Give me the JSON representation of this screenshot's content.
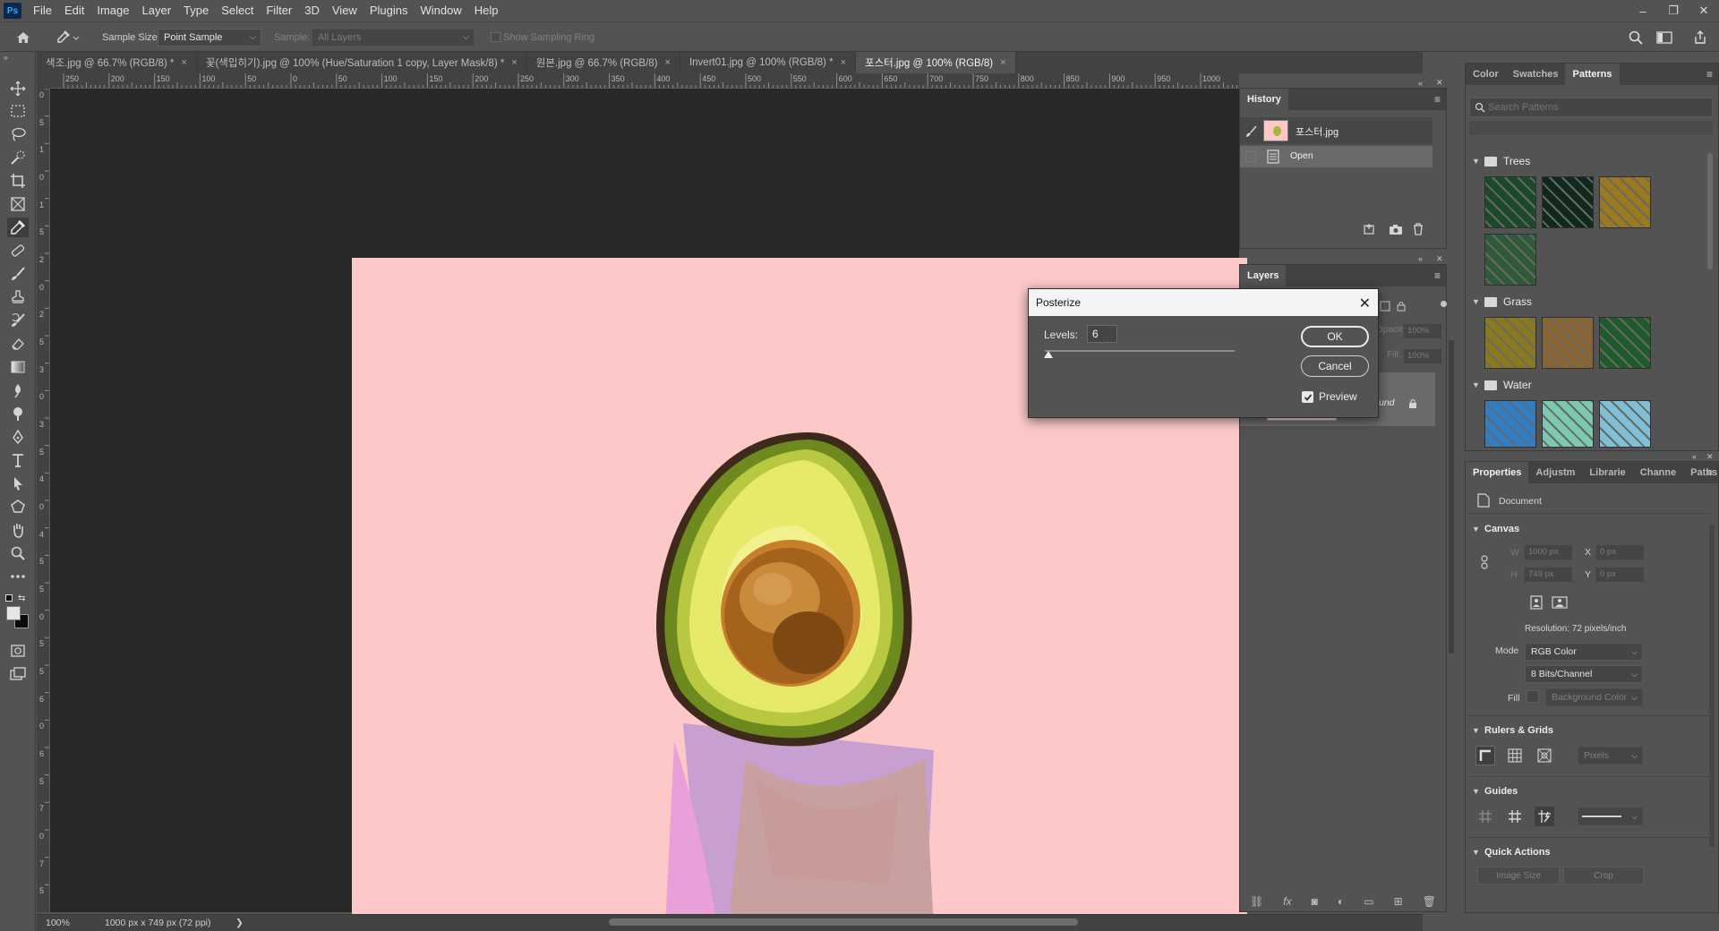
{
  "app": {
    "logo": "Ps"
  },
  "menu": [
    "File",
    "Edit",
    "Image",
    "Layer",
    "Type",
    "Select",
    "Filter",
    "3D",
    "View",
    "Plugins",
    "Window",
    "Help"
  ],
  "window_controls": {
    "minimize": "–",
    "restore": "❐",
    "close": "✕"
  },
  "options_bar": {
    "sample_size_label": "Sample Size:",
    "sample_size_value": "Point Sample",
    "sample_label": "Sample:",
    "sample_value": "All Layers",
    "sampling_ring_label": "Show Sampling Ring",
    "caret": "⌵"
  },
  "tabs": [
    {
      "label": "색조.jpg @ 66.7% (RGB/8) *",
      "close": "×"
    },
    {
      "label": "꽃(색입히기).jpg @ 100% (Hue/Saturation 1 copy, Layer Mask/8) *",
      "close": "×"
    },
    {
      "label": "원본.jpg @ 66.7% (RGB/8)",
      "close": "×"
    },
    {
      "label": "Invert01.jpg @ 100% (RGB/8) *",
      "close": "×"
    },
    {
      "label": "포스터.jpg @ 100% (RGB/8)",
      "close": "×"
    }
  ],
  "ruler": {
    "top": [
      "250",
      "200",
      "150",
      "100",
      "50",
      "0",
      "50",
      "100",
      "150",
      "200",
      "250",
      "300",
      "350",
      "400",
      "450",
      "500",
      "550",
      "600",
      "650",
      "700",
      "750",
      "800",
      "850",
      "900",
      "950",
      "1000"
    ],
    "left": [
      "0",
      "5",
      "1",
      "0",
      "1",
      "5",
      "2",
      "0",
      "2",
      "5",
      "3",
      "0",
      "3",
      "5",
      "4",
      "0",
      "4",
      "5",
      "5",
      "0",
      "5",
      "5",
      "6",
      "0",
      "6",
      "5",
      "7",
      "0",
      "7",
      "5"
    ]
  },
  "status": {
    "zoom": "100%",
    "doc_info": "1000 px x 749 px (72 ppi)",
    "arrow": "❯"
  },
  "history": {
    "title": "History",
    "snapshot_name": "포스터.jpg",
    "items": [
      {
        "label": "Open"
      }
    ]
  },
  "layers": {
    "title": "Layers",
    "opacity_label": "Opacity:",
    "opacity_value": "100%",
    "fill_label": "Fill:",
    "fill_value": "100%",
    "layer_name_partial": "und"
  },
  "patterns_panel": {
    "tabs": [
      "Color",
      "Swatches",
      "Patterns"
    ],
    "search_placeholder": "Search Patterns",
    "groups": [
      {
        "name": "Trees",
        "swatches": [
          "#1b4a2a",
          "#11291c",
          "#9a7a1c",
          "#2f5a38"
        ]
      },
      {
        "name": "Grass",
        "swatches": [
          "#8a7a1e",
          "#8b6530",
          "#1e5a2a"
        ]
      },
      {
        "name": "Water",
        "swatches": [
          "#2f7fc8",
          "#7ac9b0",
          "#7ec0d6"
        ]
      }
    ]
  },
  "properties": {
    "tabs": [
      "Properties",
      "Adjustm",
      "Librarie",
      "Channe",
      "Paths"
    ],
    "doc_label": "Document",
    "canvas_title": "Canvas",
    "w_label": "W",
    "w_value": "1000 px",
    "h_label": "H",
    "h_value": "749 px",
    "x_label": "X",
    "x_value": "0 px",
    "y_label": "Y",
    "y_value": "0 px",
    "resolution": "Resolution: 72 pixels/inch",
    "mode_label": "Mode",
    "mode_value": "RGB Color",
    "bits_value": "8 Bits/Channel",
    "fill_label": "Fill",
    "fill_value": "Background Color",
    "rulers_title": "Rulers & Grids",
    "units_value": "Pixels",
    "guides_title": "Guides",
    "quick_actions_title": "Quick Actions",
    "image_size_btn": "Image Size",
    "crop_btn": "Crop"
  },
  "dialog": {
    "title": "Posterize",
    "levels_label": "Levels:",
    "levels_value": "6",
    "slider_fraction": 0.02,
    "ok": "OK",
    "cancel": "Cancel",
    "preview_label": "Preview",
    "preview_checked": true
  },
  "colors": {
    "canvas_bg": "#fcc8c8",
    "accent_blue": "#31a8ff"
  }
}
